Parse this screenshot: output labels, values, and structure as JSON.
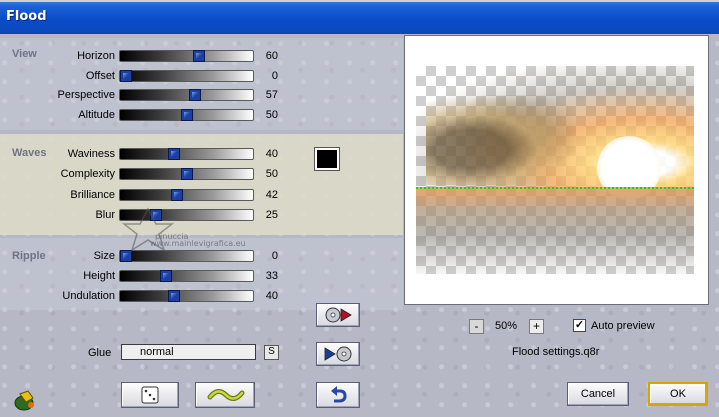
{
  "window": {
    "title": "Flood"
  },
  "sections": {
    "view": {
      "label": "View",
      "rows": [
        {
          "label": "Horizon",
          "value": "60"
        },
        {
          "label": "Offset",
          "value": "0"
        },
        {
          "label": "Perspective",
          "value": "57"
        },
        {
          "label": "Altitude",
          "value": "50"
        }
      ]
    },
    "waves": {
      "label": "Waves",
      "rows": [
        {
          "label": "Waviness",
          "value": "40"
        },
        {
          "label": "Complexity",
          "value": "50"
        },
        {
          "label": "Brilliance",
          "value": "42"
        },
        {
          "label": "Blur",
          "value": "25"
        }
      ],
      "color": "#000000"
    },
    "ripple": {
      "label": "Ripple",
      "rows": [
        {
          "label": "Size",
          "value": "0"
        },
        {
          "label": "Height",
          "value": "33"
        },
        {
          "label": "Undulation",
          "value": "40"
        }
      ]
    }
  },
  "glue": {
    "label": "Glue",
    "value": "normal",
    "button_label": "S"
  },
  "preview": {
    "zoom_out_label": "-",
    "zoom_level": "50%",
    "zoom_in_label": "+",
    "auto_preview_label": "Auto preview",
    "auto_preview_checked": true,
    "checkmark": "✓",
    "settings_name": "Flood settings.q8r"
  },
  "buttons": {
    "cancel": "Cancel",
    "ok": "OK"
  },
  "watermark": {
    "line1": "pinuccia",
    "line2": "www.mainlevigrafica.eu"
  },
  "icons": {
    "app": "paint-bucket-icon",
    "randomize": "dice-icon",
    "reset": "wave-icon",
    "undo": "undo-arrow-icon",
    "load": "disc-load-icon",
    "save": "disc-save-icon"
  }
}
